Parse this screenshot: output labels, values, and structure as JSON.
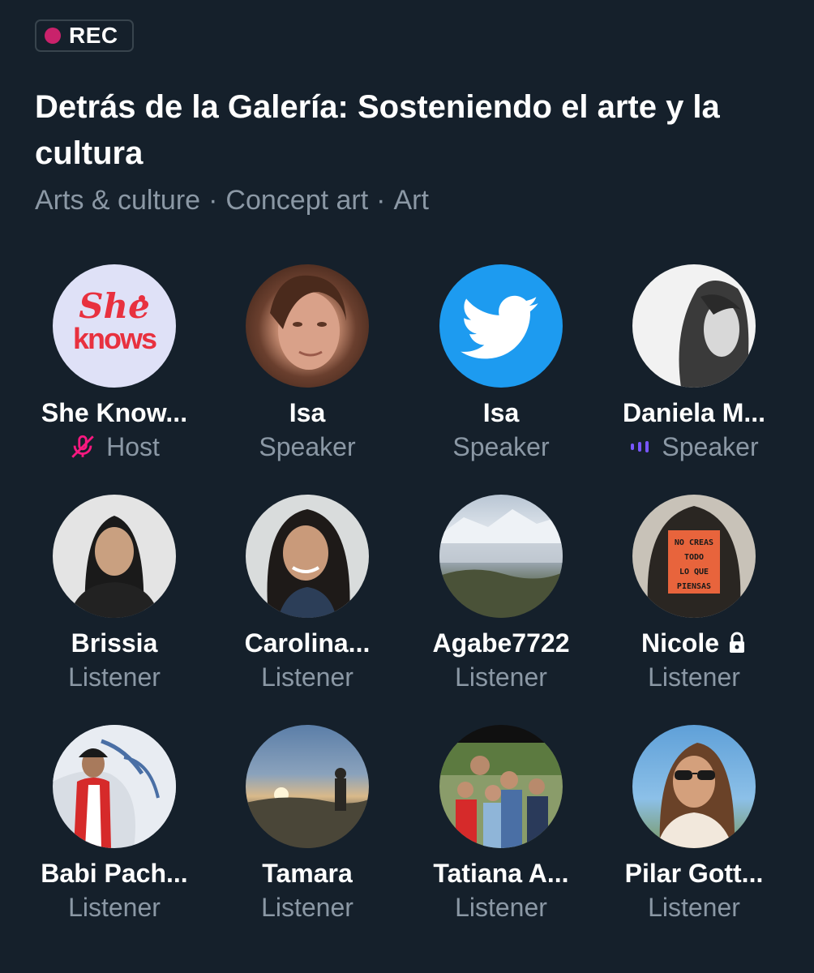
{
  "recording": {
    "label": "REC"
  },
  "space": {
    "title": "Detrás de la Galería: Sosteniendo el arte y la cultura",
    "topics": [
      "Arts & culture",
      "Concept art",
      "Art"
    ]
  },
  "participants": [
    {
      "name": "She Know...",
      "role": "Host",
      "logo_text": [
        "She",
        "knows"
      ]
    },
    {
      "name": "Isa",
      "role": "Speaker"
    },
    {
      "name": "Isa",
      "role": "Speaker"
    },
    {
      "name": "Daniela M...",
      "role": "Speaker"
    },
    {
      "name": "Brissia",
      "role": "Listener"
    },
    {
      "name": "Carolina...",
      "role": "Listener"
    },
    {
      "name": "Agabe7722",
      "role": "Listener"
    },
    {
      "name": "Nicole",
      "role": "Listener",
      "avatar_text": [
        "NO CREAS",
        "TODO",
        "LO QUE",
        "PIENSAS"
      ]
    },
    {
      "name": "Babi Pach...",
      "role": "Listener"
    },
    {
      "name": "Tamara",
      "role": "Listener"
    },
    {
      "name": "Tatiana A...",
      "role": "Listener"
    },
    {
      "name": "Pilar Gott...",
      "role": "Listener"
    }
  ],
  "colors": {
    "background": "#15202b",
    "secondary_text": "#8b98a5",
    "rec_dot": "#c9226b",
    "muted_icon": "#f91880",
    "speaking_icon": "#7856ff"
  },
  "icons": {
    "host_status": "muted-microphone-icon",
    "daniela_status": "speaking-bars-icon",
    "nicole_status": "lock-icon"
  }
}
